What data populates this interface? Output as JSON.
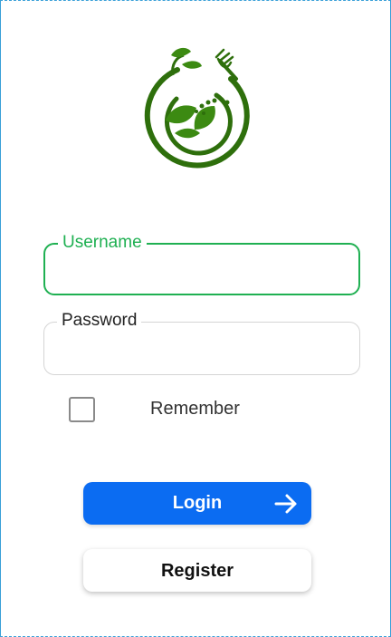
{
  "logo": {
    "icon": "leaf-fork-logo-icon",
    "color": "#2e7d0f"
  },
  "form": {
    "username": {
      "label": "Username",
      "value": ""
    },
    "password": {
      "label": "Password",
      "value": ""
    },
    "remember": {
      "label": "Remember",
      "checked": false
    }
  },
  "buttons": {
    "login_label": "Login",
    "login_icon": "arrow-right-icon",
    "register_label": "Register"
  },
  "colors": {
    "accent_green": "#1fb052",
    "primary_blue": "#0b6cf2"
  }
}
